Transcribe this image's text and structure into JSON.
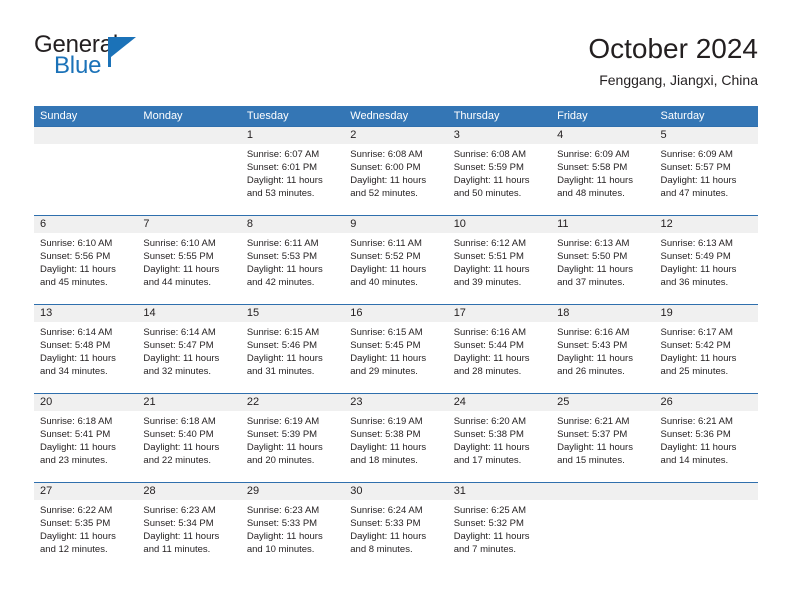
{
  "brand": {
    "word_one": "General",
    "word_two": "Blue",
    "flag_icon": "triangle-flag-icon",
    "accent_color": "#1b72b8"
  },
  "header": {
    "title": "October 2024",
    "location": "Fenggang, Jiangxi, China"
  },
  "theme": {
    "header_bar": "#3476b5",
    "row_divider": "#2f6fad",
    "day_number_band": "#f0f0f0",
    "text": "#231f20"
  },
  "weekdays": [
    "Sunday",
    "Monday",
    "Tuesday",
    "Wednesday",
    "Thursday",
    "Friday",
    "Saturday"
  ],
  "weeks": [
    [
      {
        "day": "",
        "sunrise": "",
        "sunset": "",
        "daylight_1": "",
        "daylight_2": ""
      },
      {
        "day": "",
        "sunrise": "",
        "sunset": "",
        "daylight_1": "",
        "daylight_2": ""
      },
      {
        "day": "1",
        "sunrise": "Sunrise: 6:07 AM",
        "sunset": "Sunset: 6:01 PM",
        "daylight_1": "Daylight: 11 hours",
        "daylight_2": "and 53 minutes."
      },
      {
        "day": "2",
        "sunrise": "Sunrise: 6:08 AM",
        "sunset": "Sunset: 6:00 PM",
        "daylight_1": "Daylight: 11 hours",
        "daylight_2": "and 52 minutes."
      },
      {
        "day": "3",
        "sunrise": "Sunrise: 6:08 AM",
        "sunset": "Sunset: 5:59 PM",
        "daylight_1": "Daylight: 11 hours",
        "daylight_2": "and 50 minutes."
      },
      {
        "day": "4",
        "sunrise": "Sunrise: 6:09 AM",
        "sunset": "Sunset: 5:58 PM",
        "daylight_1": "Daylight: 11 hours",
        "daylight_2": "and 48 minutes."
      },
      {
        "day": "5",
        "sunrise": "Sunrise: 6:09 AM",
        "sunset": "Sunset: 5:57 PM",
        "daylight_1": "Daylight: 11 hours",
        "daylight_2": "and 47 minutes."
      }
    ],
    [
      {
        "day": "6",
        "sunrise": "Sunrise: 6:10 AM",
        "sunset": "Sunset: 5:56 PM",
        "daylight_1": "Daylight: 11 hours",
        "daylight_2": "and 45 minutes."
      },
      {
        "day": "7",
        "sunrise": "Sunrise: 6:10 AM",
        "sunset": "Sunset: 5:55 PM",
        "daylight_1": "Daylight: 11 hours",
        "daylight_2": "and 44 minutes."
      },
      {
        "day": "8",
        "sunrise": "Sunrise: 6:11 AM",
        "sunset": "Sunset: 5:53 PM",
        "daylight_1": "Daylight: 11 hours",
        "daylight_2": "and 42 minutes."
      },
      {
        "day": "9",
        "sunrise": "Sunrise: 6:11 AM",
        "sunset": "Sunset: 5:52 PM",
        "daylight_1": "Daylight: 11 hours",
        "daylight_2": "and 40 minutes."
      },
      {
        "day": "10",
        "sunrise": "Sunrise: 6:12 AM",
        "sunset": "Sunset: 5:51 PM",
        "daylight_1": "Daylight: 11 hours",
        "daylight_2": "and 39 minutes."
      },
      {
        "day": "11",
        "sunrise": "Sunrise: 6:13 AM",
        "sunset": "Sunset: 5:50 PM",
        "daylight_1": "Daylight: 11 hours",
        "daylight_2": "and 37 minutes."
      },
      {
        "day": "12",
        "sunrise": "Sunrise: 6:13 AM",
        "sunset": "Sunset: 5:49 PM",
        "daylight_1": "Daylight: 11 hours",
        "daylight_2": "and 36 minutes."
      }
    ],
    [
      {
        "day": "13",
        "sunrise": "Sunrise: 6:14 AM",
        "sunset": "Sunset: 5:48 PM",
        "daylight_1": "Daylight: 11 hours",
        "daylight_2": "and 34 minutes."
      },
      {
        "day": "14",
        "sunrise": "Sunrise: 6:14 AM",
        "sunset": "Sunset: 5:47 PM",
        "daylight_1": "Daylight: 11 hours",
        "daylight_2": "and 32 minutes."
      },
      {
        "day": "15",
        "sunrise": "Sunrise: 6:15 AM",
        "sunset": "Sunset: 5:46 PM",
        "daylight_1": "Daylight: 11 hours",
        "daylight_2": "and 31 minutes."
      },
      {
        "day": "16",
        "sunrise": "Sunrise: 6:15 AM",
        "sunset": "Sunset: 5:45 PM",
        "daylight_1": "Daylight: 11 hours",
        "daylight_2": "and 29 minutes."
      },
      {
        "day": "17",
        "sunrise": "Sunrise: 6:16 AM",
        "sunset": "Sunset: 5:44 PM",
        "daylight_1": "Daylight: 11 hours",
        "daylight_2": "and 28 minutes."
      },
      {
        "day": "18",
        "sunrise": "Sunrise: 6:16 AM",
        "sunset": "Sunset: 5:43 PM",
        "daylight_1": "Daylight: 11 hours",
        "daylight_2": "and 26 minutes."
      },
      {
        "day": "19",
        "sunrise": "Sunrise: 6:17 AM",
        "sunset": "Sunset: 5:42 PM",
        "daylight_1": "Daylight: 11 hours",
        "daylight_2": "and 25 minutes."
      }
    ],
    [
      {
        "day": "20",
        "sunrise": "Sunrise: 6:18 AM",
        "sunset": "Sunset: 5:41 PM",
        "daylight_1": "Daylight: 11 hours",
        "daylight_2": "and 23 minutes."
      },
      {
        "day": "21",
        "sunrise": "Sunrise: 6:18 AM",
        "sunset": "Sunset: 5:40 PM",
        "daylight_1": "Daylight: 11 hours",
        "daylight_2": "and 22 minutes."
      },
      {
        "day": "22",
        "sunrise": "Sunrise: 6:19 AM",
        "sunset": "Sunset: 5:39 PM",
        "daylight_1": "Daylight: 11 hours",
        "daylight_2": "and 20 minutes."
      },
      {
        "day": "23",
        "sunrise": "Sunrise: 6:19 AM",
        "sunset": "Sunset: 5:38 PM",
        "daylight_1": "Daylight: 11 hours",
        "daylight_2": "and 18 minutes."
      },
      {
        "day": "24",
        "sunrise": "Sunrise: 6:20 AM",
        "sunset": "Sunset: 5:38 PM",
        "daylight_1": "Daylight: 11 hours",
        "daylight_2": "and 17 minutes."
      },
      {
        "day": "25",
        "sunrise": "Sunrise: 6:21 AM",
        "sunset": "Sunset: 5:37 PM",
        "daylight_1": "Daylight: 11 hours",
        "daylight_2": "and 15 minutes."
      },
      {
        "day": "26",
        "sunrise": "Sunrise: 6:21 AM",
        "sunset": "Sunset: 5:36 PM",
        "daylight_1": "Daylight: 11 hours",
        "daylight_2": "and 14 minutes."
      }
    ],
    [
      {
        "day": "27",
        "sunrise": "Sunrise: 6:22 AM",
        "sunset": "Sunset: 5:35 PM",
        "daylight_1": "Daylight: 11 hours",
        "daylight_2": "and 12 minutes."
      },
      {
        "day": "28",
        "sunrise": "Sunrise: 6:23 AM",
        "sunset": "Sunset: 5:34 PM",
        "daylight_1": "Daylight: 11 hours",
        "daylight_2": "and 11 minutes."
      },
      {
        "day": "29",
        "sunrise": "Sunrise: 6:23 AM",
        "sunset": "Sunset: 5:33 PM",
        "daylight_1": "Daylight: 11 hours",
        "daylight_2": "and 10 minutes."
      },
      {
        "day": "30",
        "sunrise": "Sunrise: 6:24 AM",
        "sunset": "Sunset: 5:33 PM",
        "daylight_1": "Daylight: 11 hours",
        "daylight_2": "and 8 minutes."
      },
      {
        "day": "31",
        "sunrise": "Sunrise: 6:25 AM",
        "sunset": "Sunset: 5:32 PM",
        "daylight_1": "Daylight: 11 hours",
        "daylight_2": "and 7 minutes."
      },
      {
        "day": "",
        "sunrise": "",
        "sunset": "",
        "daylight_1": "",
        "daylight_2": ""
      },
      {
        "day": "",
        "sunrise": "",
        "sunset": "",
        "daylight_1": "",
        "daylight_2": ""
      }
    ]
  ]
}
